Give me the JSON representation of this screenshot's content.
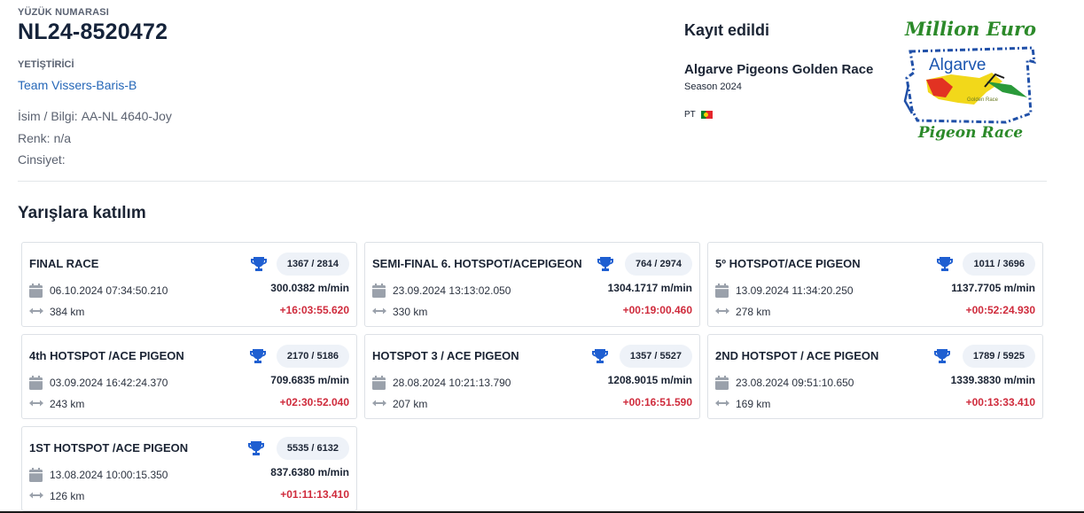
{
  "pigeon": {
    "ring_label": "YÜZÜK NUMARASI",
    "ring_number": "NL24-8520472",
    "breeder_label": "YETİŞTİRİCİ",
    "breeder_name": "Team Vissers-Baris-B",
    "name_label": "İsim / Bilgi:",
    "name_value": "AA-NL 4640-Joy",
    "color_label": "Renk:",
    "color_value": "n/a",
    "sex_label": "Cinsiyet:",
    "sex_value": ""
  },
  "registration": {
    "status": "Kayıt edildi",
    "race_name": "Algarve Pigeons Golden Race",
    "season": "Season 2024",
    "country_code": "PT"
  },
  "logo": {
    "title": "Million Euro",
    "word": "Algarve",
    "tagline": "Golden Race",
    "subtitle": "Pigeon Race"
  },
  "section_title": "Yarışlara katılım",
  "races": [
    {
      "name": "FINAL RACE",
      "rank": "1367 / 2814",
      "date": "06.10.2024 07:34:50.210",
      "speed": "300.0382 m/min",
      "distance": "384 km",
      "diff": "+16:03:55.620"
    },
    {
      "name": "SEMI-FINAL 6. HOTSPOT/ACEPIGEON",
      "rank": "764 / 2974",
      "date": "23.09.2024 13:13:02.050",
      "speed": "1304.1717 m/min",
      "distance": "330 km",
      "diff": "+00:19:00.460"
    },
    {
      "name": "5º HOTSPOT/ACE PIGEON",
      "rank": "1011 / 3696",
      "date": "13.09.2024 11:34:20.250",
      "speed": "1137.7705 m/min",
      "distance": "278 km",
      "diff": "+00:52:24.930"
    },
    {
      "name": "4th HOTSPOT /ACE PIGEON",
      "rank": "2170 / 5186",
      "date": "03.09.2024 16:42:24.370",
      "speed": "709.6835 m/min",
      "distance": "243 km",
      "diff": "+02:30:52.040"
    },
    {
      "name": "HOTSPOT 3 / ACE PIGEON",
      "rank": "1357 / 5527",
      "date": "28.08.2024 10:21:13.790",
      "speed": "1208.9015 m/min",
      "distance": "207 km",
      "diff": "+00:16:51.590"
    },
    {
      "name": "2ND HOTSPOT / ACE PIGEON",
      "rank": "1789 / 5925",
      "date": "23.08.2024 09:51:10.650",
      "speed": "1339.3830 m/min",
      "distance": "169 km",
      "diff": "+00:13:33.410"
    },
    {
      "name": "1ST HOTSPOT /ACE PIGEON",
      "rank": "5535 / 6132",
      "date": "13.08.2024 10:00:15.350",
      "speed": "837.6380 m/min",
      "distance": "126 km",
      "diff": "+01:11:13.410"
    }
  ],
  "colors": {
    "accent_blue": "#2567b8",
    "trophy_blue": "#1f5fd1",
    "negative_red": "#cf2b3c",
    "rank_pill_bg": "#eef2f8",
    "logo_green": "#2c8a2a"
  },
  "icons": {
    "trophy": "trophy-icon",
    "calendar": "calendar-icon",
    "distance": "distance-arrows-icon",
    "flag": "portugal-flag-icon"
  }
}
